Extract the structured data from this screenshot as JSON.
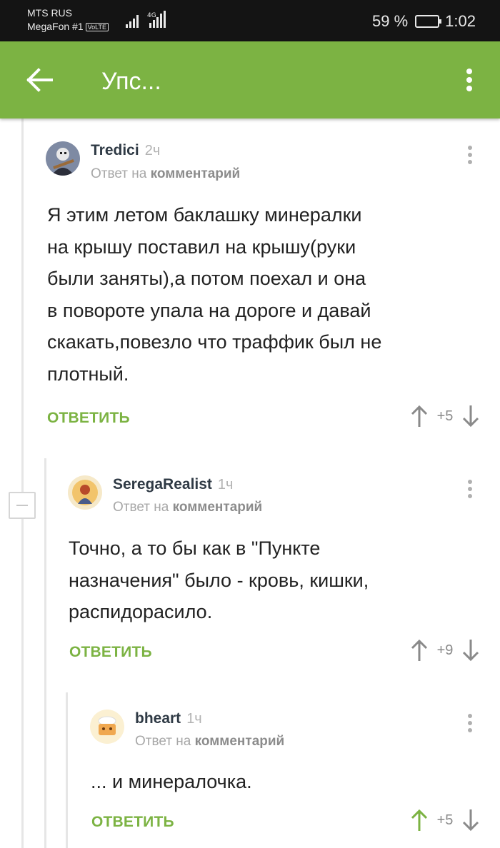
{
  "status_bar": {
    "carrier_1": "MTS RUS",
    "carrier_2": "MegaFon #1",
    "volte": "VoLTE",
    "network": "4G",
    "battery": "59 %",
    "battery_level": 0.59,
    "time": "1:02"
  },
  "toolbar": {
    "title": "Упс...",
    "back_icon": "arrow-left-icon",
    "menu_icon": "more-vertical-icon",
    "color": "#7cb343"
  },
  "comments": [
    {
      "user": "Tredici",
      "time": "2ч",
      "reply_prefix": "Ответ на",
      "reply_target": "комментарий",
      "lines": [
        "Я этим летом баклашку минералки",
        "на крышу поставил на крышу(руки",
        "были заняты),а потом поехал и она",
        "в повороте упала на дороге и давай",
        "скакать,повезло что траффик был не",
        "плотный."
      ],
      "reply_label": "ОТВЕТИТЬ",
      "score": "+5",
      "upvoted": false
    },
    {
      "user": "SeregaRealist",
      "time": "1ч",
      "reply_prefix": "Ответ на",
      "reply_target": "комментарий",
      "lines": [
        "Точно, а то бы как в \"Пункте",
        "назначения\" было - кровь, кишки,",
        "распидорасило."
      ],
      "reply_label": "ОТВЕТИТЬ",
      "score": "+9",
      "upvoted": false
    },
    {
      "user": "bheart",
      "time": "1ч",
      "reply_prefix": "Ответ на",
      "reply_target": "комментарий",
      "lines": [
        "... и минералочка."
      ],
      "reply_label": "ОТВЕТИТЬ",
      "score": "+5",
      "upvoted": true
    }
  ],
  "colors": {
    "accent": "#7cb343",
    "vote_neutral": "#8a8a8a",
    "vote_active": "#7cb343"
  }
}
